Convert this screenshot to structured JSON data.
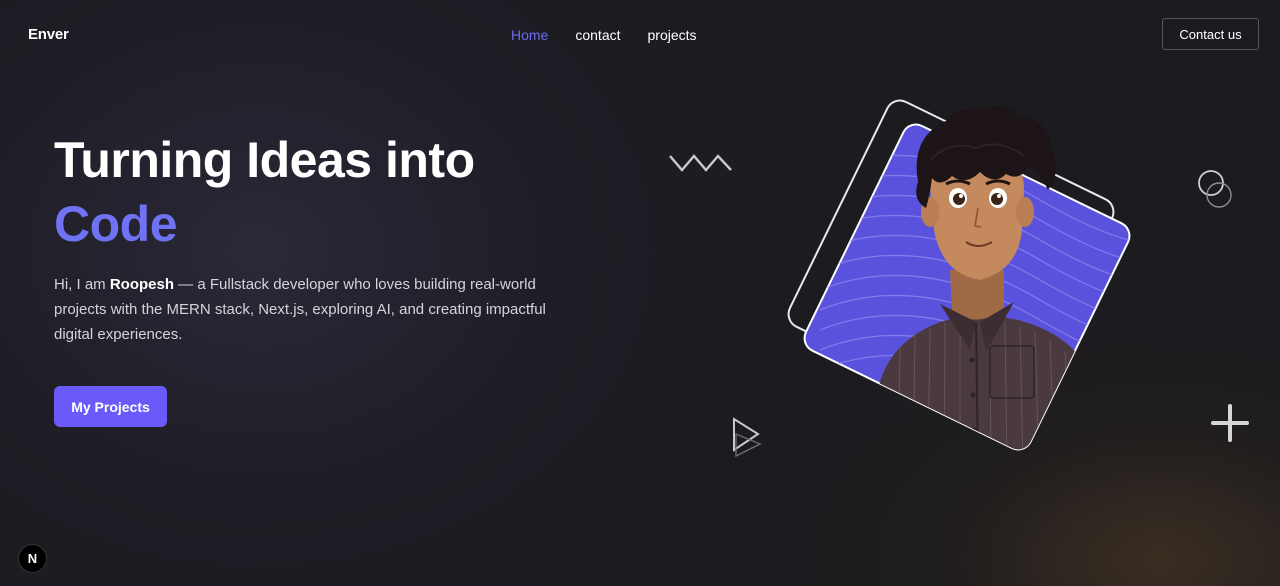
{
  "nav": {
    "brand": "Enver",
    "links": [
      {
        "label": "Home",
        "active": true
      },
      {
        "label": "contact",
        "active": false
      },
      {
        "label": "projects",
        "active": false
      }
    ],
    "contact_button": "Contact us"
  },
  "hero": {
    "title_line1": "Turning Ideas into",
    "title_accent": "Code",
    "desc_prefix": "Hi, I am ",
    "desc_name": "Roopesh",
    "desc_rest": " — a Fullstack developer who loves building real-world projects with the MERN stack, Next.js, exploring AI, and creating impactful digital experiences.",
    "cta_button": "My Projects"
  },
  "badge": {
    "label": "N"
  },
  "icons": [
    "zigzag-icon",
    "circles-icon",
    "play-triangle-icon",
    "plus-icon",
    "nextjs-icon"
  ],
  "colors": {
    "accent": "#6f72f2",
    "button": "#6a5af9",
    "nav_active": "#6b6cf0",
    "background": "#1c1b20",
    "portrait_bg": "#5a52dc"
  }
}
